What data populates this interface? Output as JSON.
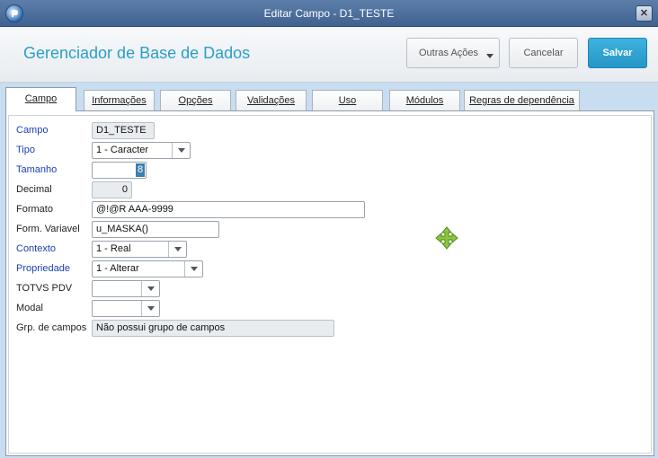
{
  "window": {
    "title": "Editar Campo - D1_TESTE"
  },
  "header": {
    "heading": "Gerenciador de Base de Dados",
    "more_actions": "Outras Ações",
    "cancel": "Cancelar",
    "save": "Salvar"
  },
  "tabs": [
    "Campo",
    "Informações",
    "Opções",
    "Validações",
    "Uso",
    "Módulos",
    "Regras de dependência"
  ],
  "form": {
    "campo": {
      "label": "Campo",
      "value": "D1_TESTE"
    },
    "tipo": {
      "label": "Tipo",
      "value": "1 - Caracter"
    },
    "tamanho": {
      "label": "Tamanho",
      "value": "8"
    },
    "decimal": {
      "label": "Decimal",
      "value": "0"
    },
    "formato": {
      "label": "Formato",
      "value": "@!@R AAA-9999"
    },
    "form_variavel": {
      "label": "Form. Variavel",
      "value": "u_MASKA()"
    },
    "contexto": {
      "label": "Contexto",
      "value": "1 - Real"
    },
    "propriedade": {
      "label": "Propriedade",
      "value": "1 - Alterar"
    },
    "totvs_pdv": {
      "label": "TOTVS PDV",
      "value": ""
    },
    "modal": {
      "label": "Modal",
      "value": ""
    },
    "grp_campos": {
      "label": "Grp. de campos",
      "value": "Não possui grupo de campos"
    }
  },
  "icons": {
    "app": "app-logo-icon",
    "close": "close-icon",
    "move": "move-cursor-icon"
  },
  "colors": {
    "accent": "#2a9fc6",
    "save_button": "#2596c7",
    "required_label": "#1a3fb4",
    "titlebar": "#4a6d9c"
  }
}
